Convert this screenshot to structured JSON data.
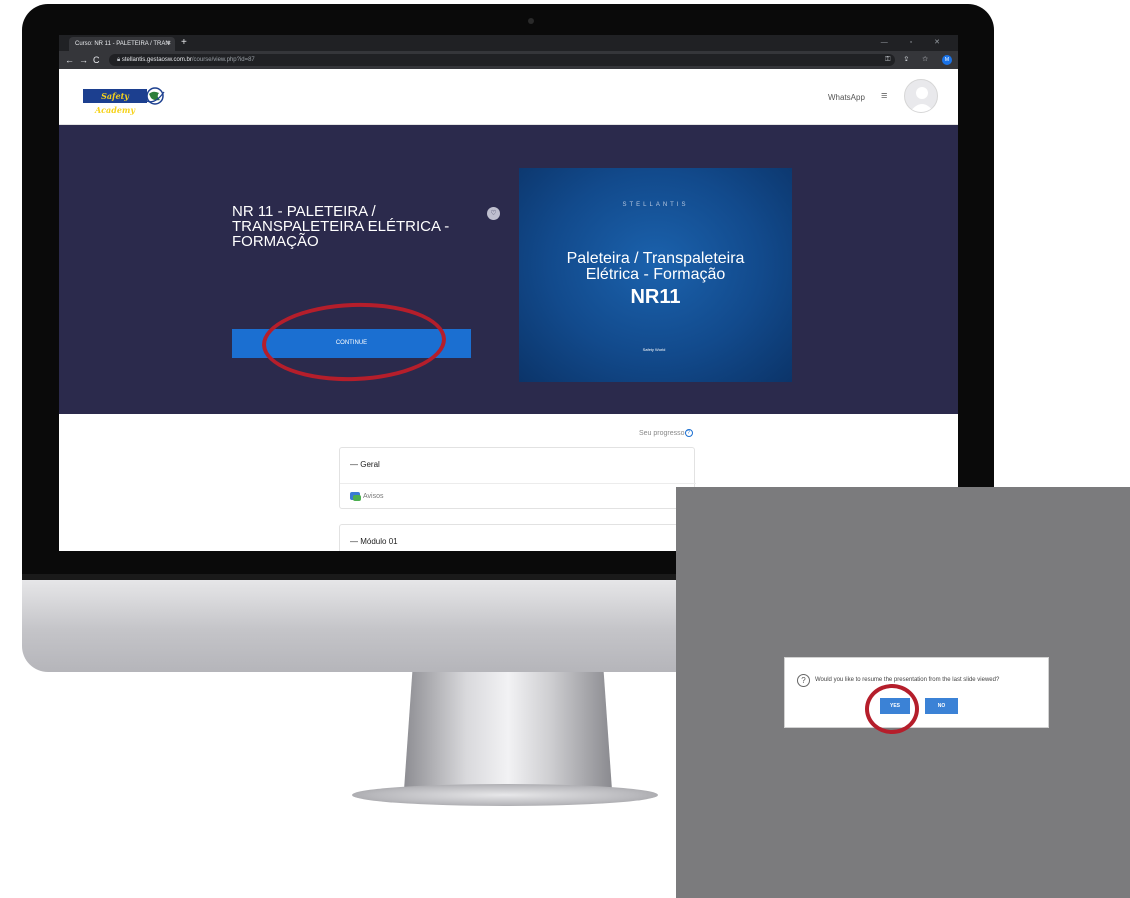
{
  "browser": {
    "tab_title": "Curso: NR 11 - PALETEIRA / TRAN",
    "tab_close": "×",
    "new_tab": "+",
    "back": "←",
    "forward": "→",
    "reload": "C",
    "url_host": "stellantis.gestaosw.com.br",
    "url_path": "/course/view.php?id=87",
    "profile_initial": "M"
  },
  "header": {
    "logo_text": "Safety Academy",
    "whatsapp_label": "WhatsApp",
    "menu_glyph": "≡"
  },
  "hero": {
    "course_title": "NR 11 - PALETEIRA / TRANSPALETEIRA ELÉTRICA - FORMAÇÃO",
    "favorite_glyph": "♡",
    "continue_label": "CONTINUE",
    "banner_brand": "STELLANTIS",
    "banner_line1": "Paleteira / Transpaleteira",
    "banner_line2": "Elétrica - Formação",
    "banner_code": "NR11",
    "banner_badge": "Safety World"
  },
  "content": {
    "progress_label": "Seu progresso",
    "progress_icon": "?",
    "sections": [
      {
        "title": "Geral",
        "items": [
          "Avisos"
        ]
      },
      {
        "title": "Módulo 01"
      }
    ]
  },
  "dialog": {
    "question_icon": "?",
    "message": "Would you like to resume the presentation from the last slide viewed?",
    "yes_label": "YES",
    "no_label": "NO"
  },
  "colors": {
    "hero_bg": "#2b2a4c",
    "continue_btn": "#1b6fd1",
    "highlight_ring": "#b51e2b",
    "overlay_bg": "#7b7b7d",
    "dialog_btn": "#3b82d6"
  }
}
